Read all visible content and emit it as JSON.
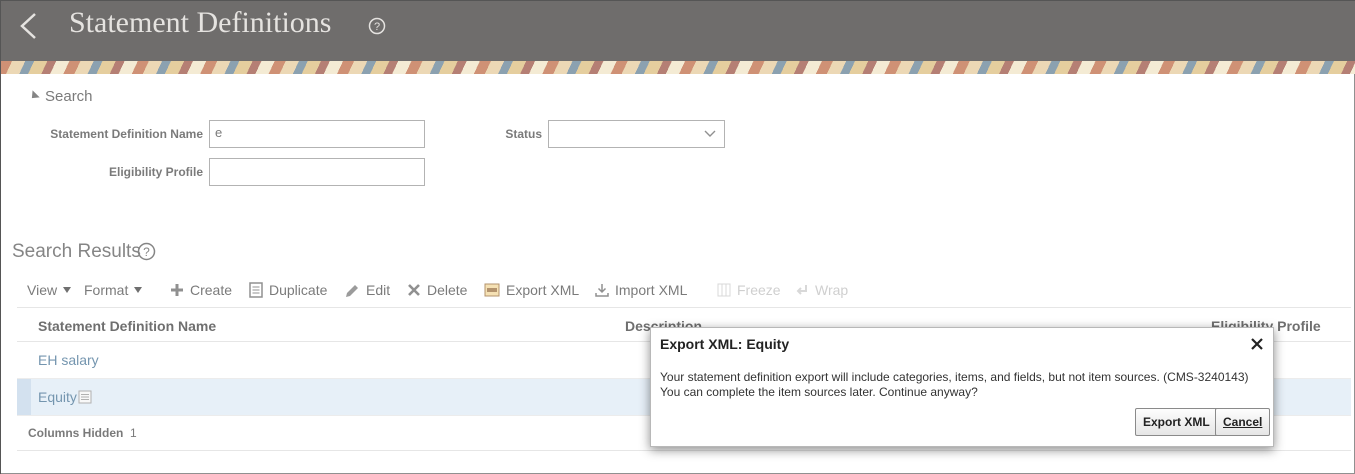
{
  "header": {
    "title": "Statement Definitions"
  },
  "search": {
    "toggle_label": "Search",
    "fields": {
      "name_label": "Statement Definition Name",
      "name_value": "e",
      "status_label": "Status",
      "status_value": "",
      "eligibility_label": "Eligibility Profile",
      "eligibility_value": ""
    }
  },
  "results": {
    "title": "Search Results",
    "toolbar": {
      "view": "View",
      "format": "Format",
      "create": "Create",
      "duplicate": "Duplicate",
      "edit": "Edit",
      "delete": "Delete",
      "export_xml": "Export XML",
      "import_xml": "Import XML",
      "freeze": "Freeze",
      "wrap": "Wrap"
    },
    "columns": [
      "Statement Definition Name",
      "Description",
      "Eligibility Profile"
    ],
    "rows": [
      {
        "name": "EH salary",
        "selected": false
      },
      {
        "name": "Equity",
        "selected": true
      }
    ],
    "footer": {
      "columns_hidden_label": "Columns Hidden",
      "columns_hidden_count": "1"
    }
  },
  "dialog": {
    "title": "Export XML: Equity",
    "message_line1": "Your statement definition export will include categories, items, and fields, but not item sources. (CMS-3240143)",
    "message_line2": "You can complete the item sources later. Continue anyway?",
    "export_button": "Export XML",
    "cancel_button": "Cancel"
  },
  "colors": {
    "header_bg": "#231f1e",
    "link": "#2a5d84",
    "selected_row": "#dbe9f5"
  }
}
